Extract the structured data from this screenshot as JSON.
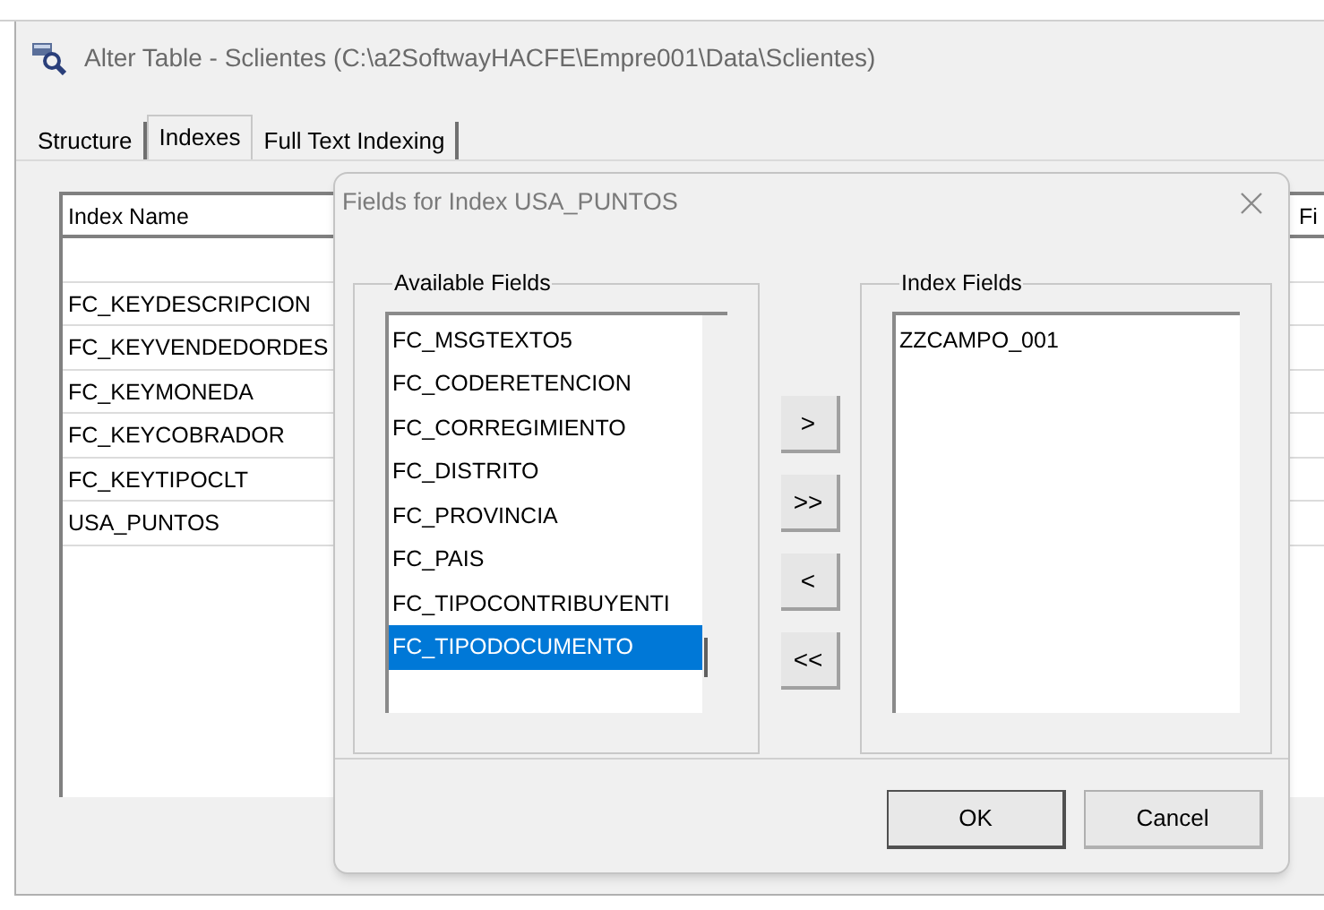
{
  "window": {
    "title": "Alter Table - Sclientes (C:\\a2SoftwayHACFE\\Empre001\\Data\\Sclientes)"
  },
  "tabs": [
    {
      "label": "Structure",
      "selected": false
    },
    {
      "label": "Indexes",
      "selected": true
    },
    {
      "label": "Full Text Indexing",
      "selected": false
    }
  ],
  "index_grid": {
    "columns": [
      "Index Name",
      "Fi"
    ],
    "rows": [
      "FC_KEYDESCRIPCION",
      "FC_KEYVENDEDORDES",
      "FC_KEYMONEDA",
      "FC_KEYCOBRADOR",
      "FC_KEYTIPOCLT",
      "USA_PUNTOS"
    ]
  },
  "dialog": {
    "title": "Fields for Index USA_PUNTOS",
    "available_fields": {
      "label": "Available Fields",
      "items": [
        {
          "text": "FC_MSGTEXTO5",
          "selected": false
        },
        {
          "text": "FC_CODERETENCION",
          "selected": false
        },
        {
          "text": "FC_CORREGIMIENTO",
          "selected": false
        },
        {
          "text": "FC_DISTRITO",
          "selected": false
        },
        {
          "text": "FC_PROVINCIA",
          "selected": false
        },
        {
          "text": "FC_PAIS",
          "selected": false
        },
        {
          "text": "FC_TIPOCONTRIBUYENTI",
          "selected": false
        },
        {
          "text": "FC_TIPODOCUMENTO",
          "selected": true
        }
      ]
    },
    "move_buttons": [
      ">",
      ">>",
      "<",
      "<<"
    ],
    "index_fields": {
      "label": "Index Fields",
      "items": [
        {
          "text": "ZZCAMPO_001",
          "selected": false
        }
      ]
    },
    "buttons": [
      {
        "label": "OK",
        "default": true
      },
      {
        "label": "Cancel",
        "default": false
      }
    ]
  }
}
